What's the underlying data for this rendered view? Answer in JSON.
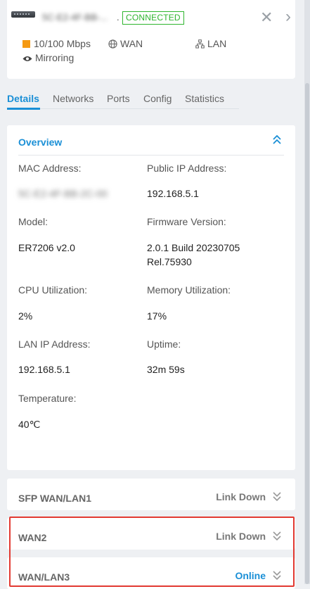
{
  "header": {
    "device_name": "5C-E2-4F-BB-...",
    "status_badge": "CONNECTED",
    "colors": {
      "connected": "#2eb52e",
      "accent": "#1a8fd6",
      "alert": "#e23a32",
      "speed_swatch": "#f59a13"
    },
    "icons": [
      "router-device-icon",
      "close-icon",
      "chevron-right-icon"
    ]
  },
  "legend": {
    "speed": "10/100 Mbps",
    "wan": "WAN",
    "lan": "LAN",
    "mirroring": "Mirroring",
    "icons": [
      "speed-swatch-icon",
      "globe-icon",
      "network-icon",
      "eye-icon"
    ]
  },
  "tabs": [
    {
      "label": "Details",
      "active": true
    },
    {
      "label": "Networks",
      "active": false
    },
    {
      "label": "Ports",
      "active": false
    },
    {
      "label": "Config",
      "active": false
    },
    {
      "label": "Statistics",
      "active": false
    }
  ],
  "overview": {
    "title": "Overview",
    "fields": [
      {
        "label": "MAC Address:",
        "value": "5C-E2-4F-BB-2C-00"
      },
      {
        "label": "Public IP Address:",
        "value": "192.168.5.1"
      },
      {
        "label": "Model:",
        "value": "ER7206 v2.0"
      },
      {
        "label": "Firmware Version:",
        "value_line1": "2.0.1 Build 20230705",
        "value_line2": "Rel.75930"
      },
      {
        "label": "CPU Utilization:",
        "value": "2%"
      },
      {
        "label": "Memory Utilization:",
        "value": "17%"
      },
      {
        "label": "LAN IP Address:",
        "value": "192.168.5.1"
      },
      {
        "label": "Uptime:",
        "value": "32m 59s"
      },
      {
        "label": "Temperature:",
        "value": "40℃"
      }
    ]
  },
  "sections": [
    {
      "title": "SFP WAN/LAN1",
      "status": "Link Down"
    },
    {
      "title": "WAN2",
      "status": "Link Down"
    },
    {
      "title": "WAN/LAN3",
      "status": "Online"
    }
  ]
}
